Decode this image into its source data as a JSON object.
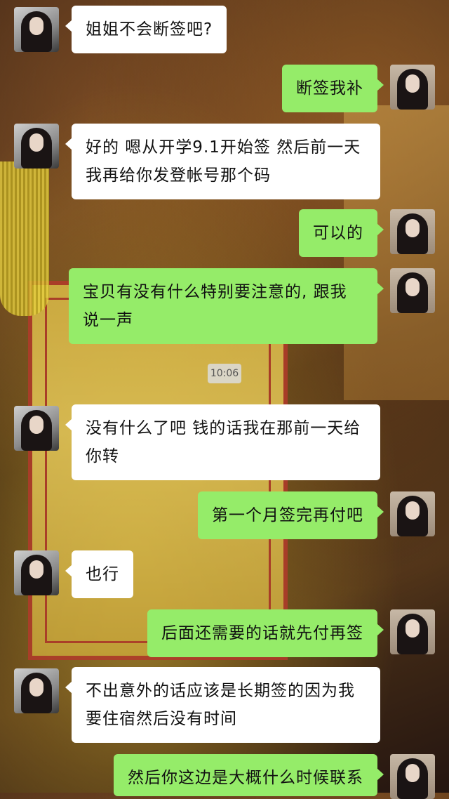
{
  "timestamp": "10:06",
  "messages": [
    {
      "side": "in",
      "text": "姐姐不会断签吧?"
    },
    {
      "side": "out",
      "text": "断签我补"
    },
    {
      "side": "in",
      "text": "好的 嗯从开学9.1开始签 然后前一天我再给你发登帐号那个码"
    },
    {
      "side": "out",
      "text": "可以的"
    },
    {
      "side": "out",
      "text": "宝贝有没有什么特别要注意的, 跟我说一声"
    },
    {
      "side": "in",
      "text": "没有什么了吧 钱的话我在那前一天给你转"
    },
    {
      "side": "out",
      "text": "第一个月签完再付吧"
    },
    {
      "side": "in",
      "text": "也行"
    },
    {
      "side": "out",
      "text": "后面还需要的话就先付再签"
    },
    {
      "side": "in",
      "text": "不出意外的话应该是长期签的因为我要住宿然后没有时间"
    },
    {
      "side": "out",
      "text": "然后你这边是大概什么时候联系"
    }
  ]
}
